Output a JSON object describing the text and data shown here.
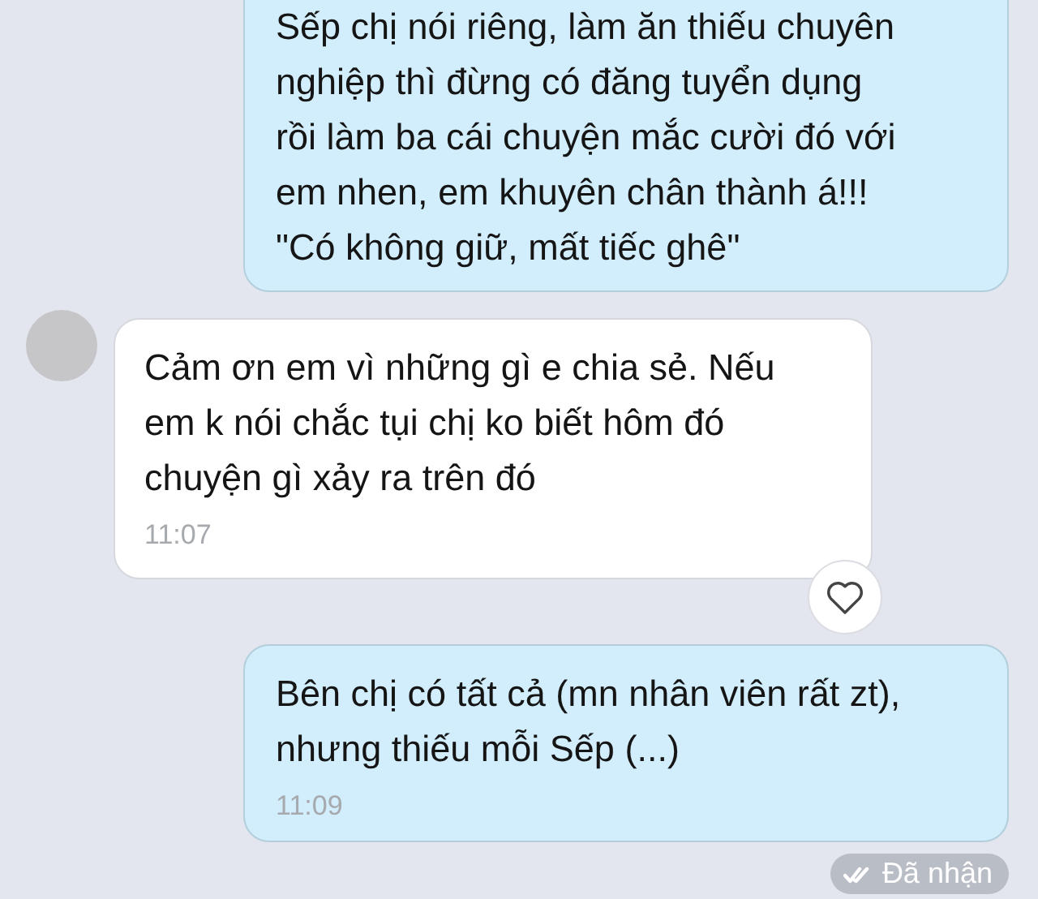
{
  "messages": [
    {
      "kind": "outgoing",
      "text": "Sếp chị nói riêng, làm ăn thiếu chuyên\nnghiệp thì đừng có đăng tuyển dụng\nrồi làm ba cái chuyện mắc cười đó với\nem nhen, em khuyên chân thành á!!!\n\"Có không giữ, mất tiếc ghê\""
    },
    {
      "kind": "incoming",
      "text": "Cảm ơn em vì những gì e chia sẻ. Nếu\nem k nói chắc tụi chị ko biết hôm đó\nchuyện gì xảy ra trên đó",
      "time": "11:07",
      "react_button": true
    },
    {
      "kind": "outgoing",
      "text": "Bên chị có tất cả (mn nhân viên rất zt),\nnhưng thiếu mỗi Sếp (...)",
      "time": "11:09",
      "status": "Đã nhận"
    }
  ]
}
